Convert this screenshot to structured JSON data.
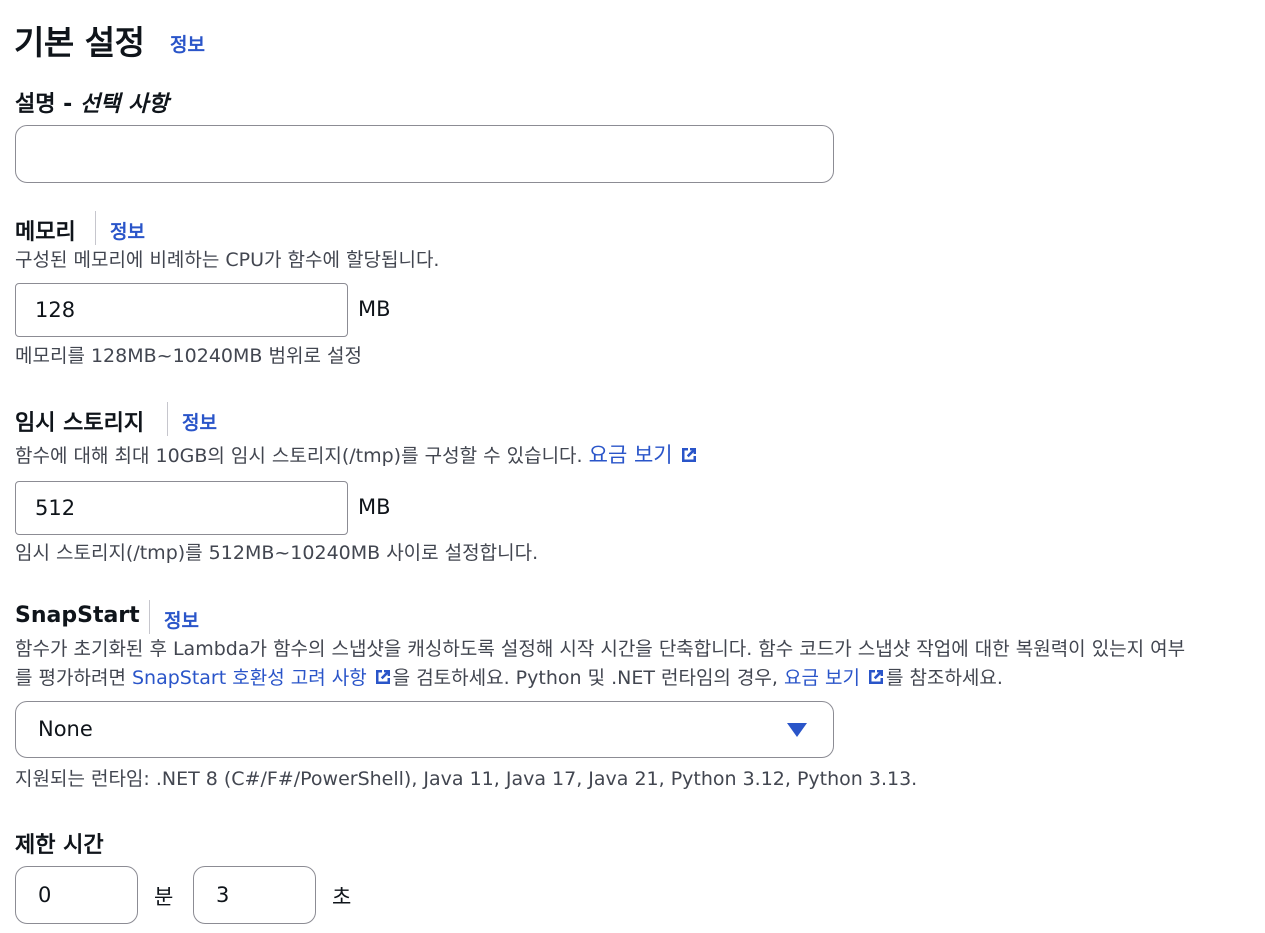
{
  "header": {
    "title": "기본 설정",
    "info": "정보"
  },
  "description_field": {
    "label": "설명",
    "separator": " - ",
    "optional": "선택 사항",
    "value": "",
    "placeholder": ""
  },
  "memory": {
    "label": "메모리",
    "info": "정보",
    "description": "구성된 메모리에 비례하는 CPU가 함수에 할당됩니다.",
    "value": "128",
    "unit": "MB",
    "constraint": "메모리를 128MB~10240MB 범위로 설정"
  },
  "ephemeral_storage": {
    "label": "임시 스토리지",
    "info": "정보",
    "description": "함수에 대해 최대 10GB의 임시 스토리지(/tmp)를 구성할 수 있습니다.",
    "pricing_link": "요금 보기",
    "value": "512",
    "unit": "MB",
    "constraint": "임시 스토리지(/tmp)를 512MB~10240MB 사이로 설정합니다."
  },
  "snapstart": {
    "label": "SnapStart",
    "info": "정보",
    "description_line1": "함수가 초기화된 후 Lambda가 함수의 스냅샷을 캐싱하도록 설정해 시작 시간을 단축합니다. 함수 코드가 스냅샷 작업에 대한 복원력이 있는지 여부",
    "description_line2_pre": "를 평가하려면 ",
    "compat_link": "SnapStart 호환성 고려 사항",
    "description_line2_mid": "을 검토하세요. Python 및 .NET 런타임의 경우, ",
    "pricing_link": "요금 보기",
    "description_line2_post": "를 참조하세요.",
    "selected": "None",
    "supported": "지원되는 런타임: .NET 8 (C#/F#/PowerShell), Java 11, Java 17, Java 21, Python 3.12, Python 3.13."
  },
  "timeout": {
    "label": "제한 시간",
    "minutes_value": "0",
    "minutes_unit": "분",
    "seconds_value": "3",
    "seconds_unit": "초"
  },
  "icons": {
    "external_link": "external-link-icon",
    "dropdown_caret": "caret-down-icon"
  },
  "colors": {
    "link": "#2a55c9",
    "text": "#0f141a",
    "secondary_text": "#424650",
    "border": "#8c8c94"
  }
}
